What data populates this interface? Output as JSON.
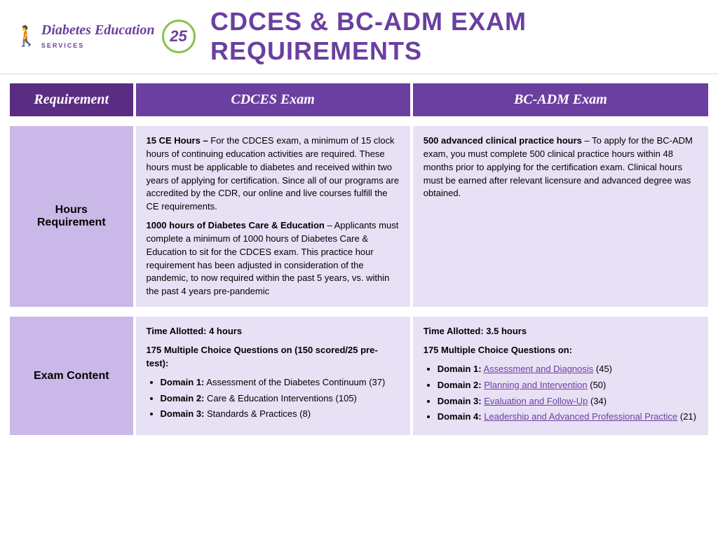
{
  "header": {
    "logo_text_line1": "Diabetes Education",
    "logo_text_line2": "SERVICES",
    "anniversary_number": "25",
    "anniversary_label": "",
    "main_title": "CDCES & BC-ADM EXAM REQUIREMENTS"
  },
  "table": {
    "columns": {
      "req": "Requirement",
      "cdces": "CDCES Exam",
      "bcadm": "BC-ADM Exam"
    },
    "rows": [
      {
        "label": "Hours\nRequirement",
        "cdces_content_parts": [
          {
            "bold": "15 CE Hours –",
            "text": " For the CDCES exam, a minimum of 15 clock hours of continuing education activities are required. These hours must be applicable to diabetes and received within two years of applying for certification. Since all of our programs are accredited by the CDR, our online and live courses fulfill the CE requirements."
          },
          {
            "bold": "1000 hours of Diabetes Care & Education",
            "text": " – Applicants must complete a minimum of 1000 hours of Diabetes Care & Education to sit for the CDCES exam. This practice hour requirement has been adjusted in consideration of the pandemic, to now required within the past 5 years, vs. within the past 4 years pre-pandemic"
          }
        ],
        "bcadm_content": "500 advanced clinical practice hours – To apply for the BC-ADM exam, you must complete 500 clinical practice hours within 48 months prior to applying for the certification exam. Clinical hours must be earned after relevant licensure and advanced degree was obtained.",
        "bcadm_bold": "500 advanced clinical practice hours"
      },
      {
        "label": "Exam\nContent",
        "cdces_time": "Time Allotted: 4 hours",
        "cdces_questions_header": "175 Multiple Choice Questions on (150 scored/25 pre-test):",
        "cdces_domains": [
          {
            "bold": "Domain 1:",
            "text": " Assessment of the Diabetes Continuum (37)"
          },
          {
            "bold": "Domain 2:",
            "text": " Care & Education Interventions (105)"
          },
          {
            "bold": "Domain 3:",
            "text": " Standards & Practices (8)"
          }
        ],
        "bcadm_time": "Time Allotted: 3.5 hours",
        "bcadm_questions_header": "175 Multiple Choice Questions on:",
        "bcadm_domains": [
          {
            "bold": "Domain 1:",
            "link": "Assessment and Diagnosis",
            "text": " (45)"
          },
          {
            "bold": "Domain 2:",
            "link": "Planning and Intervention",
            "text": " (50)"
          },
          {
            "bold": "Domain 3:",
            "link": "Evaluation and Follow-Up",
            "text": " (34)"
          },
          {
            "bold": "Domain 4:",
            "link": "Leadership and Advanced Professional Practice",
            "text": " (21)"
          }
        ]
      }
    ]
  }
}
